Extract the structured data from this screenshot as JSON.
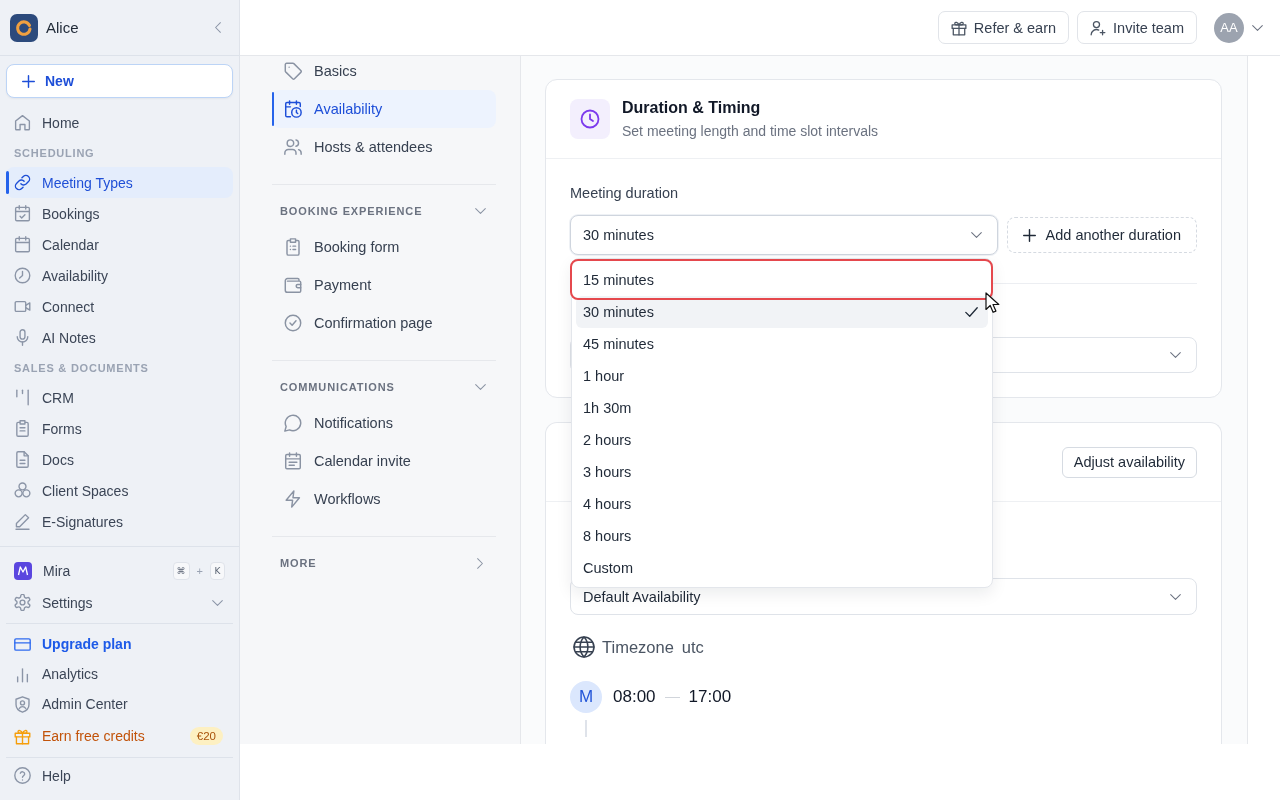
{
  "sidebar": {
    "workspace": "Alice",
    "new_button": "New",
    "top_items": [
      {
        "label": "Home",
        "selected": false
      }
    ],
    "sections": [
      {
        "title": "SCHEDULING",
        "items": [
          {
            "label": "Meeting Types",
            "selected": true
          },
          {
            "label": "Bookings",
            "selected": false
          },
          {
            "label": "Calendar",
            "selected": false
          },
          {
            "label": "Availability",
            "selected": false
          },
          {
            "label": "Connect",
            "selected": false
          },
          {
            "label": "AI Notes",
            "selected": false
          }
        ]
      },
      {
        "title": "SALES & DOCUMENTS",
        "items": [
          {
            "label": "CRM",
            "selected": false
          },
          {
            "label": "Forms",
            "selected": false
          },
          {
            "label": "Docs",
            "selected": false
          },
          {
            "label": "Client Spaces",
            "selected": false
          },
          {
            "label": "E-Signatures",
            "selected": false
          }
        ]
      }
    ],
    "assistant": {
      "label": "Mira",
      "shortcut_keys": [
        "⌘",
        "K"
      ],
      "shortcut_joiner": "+"
    },
    "settings": {
      "label": "Settings",
      "expanded": false
    },
    "footer_items": [
      {
        "kind": "upgrade",
        "label": "Upgrade plan"
      },
      {
        "kind": "plain",
        "label": "Analytics"
      },
      {
        "kind": "plain",
        "label": "Admin Center"
      },
      {
        "kind": "reward",
        "label": "Earn free credits",
        "badge": "€20"
      }
    ],
    "help": "Help"
  },
  "top_bar": {
    "buttons": [
      "Refer & earn",
      "Invite team"
    ],
    "avatar": "AA"
  },
  "event_settings_nav": {
    "items": [
      {
        "label": "Basics",
        "selected": false
      },
      {
        "label": "Availability",
        "selected": true
      },
      {
        "label": "Hosts & attendees",
        "selected": false
      }
    ],
    "groups": [
      {
        "title": "BOOKING EXPERIENCE",
        "expanded": true,
        "items": [
          {
            "label": "Booking form",
            "selected": false
          },
          {
            "label": "Payment",
            "selected": false
          },
          {
            "label": "Confirmation page",
            "selected": false
          }
        ]
      },
      {
        "title": "COMMUNICATIONS",
        "expanded": true,
        "items": [
          {
            "label": "Notifications",
            "selected": false
          },
          {
            "label": "Calendar invite",
            "selected": false
          },
          {
            "label": "Workflows",
            "selected": false
          }
        ]
      },
      {
        "title": "MORE",
        "expanded": false
      }
    ]
  },
  "duration_card": {
    "title": "Duration & Timing",
    "subtitle": "Set meeting length and time slot intervals",
    "duration_label": "Meeting duration",
    "duration_select": {
      "value": "30 minutes",
      "expanded": true,
      "options": [
        {
          "label": "15 minutes",
          "selected": false,
          "highlighted": true
        },
        {
          "label": "30 minutes",
          "selected": true,
          "highlighted": false
        },
        {
          "label": "45 minutes",
          "selected": false,
          "highlighted": false
        },
        {
          "label": "1 hour",
          "selected": false,
          "highlighted": false
        },
        {
          "label": "1h 30m",
          "selected": false,
          "highlighted": false
        },
        {
          "label": "2 hours",
          "selected": false,
          "highlighted": false
        },
        {
          "label": "3 hours",
          "selected": false,
          "highlighted": false
        },
        {
          "label": "4 hours",
          "selected": false,
          "highlighted": false
        },
        {
          "label": "8 hours",
          "selected": false,
          "highlighted": false
        },
        {
          "label": "Custom",
          "selected": false,
          "highlighted": false
        }
      ]
    },
    "add_button": "Add another duration"
  },
  "availability_card": {
    "button": "Adjust availability",
    "schedule_select": {
      "value": "Default Availability"
    },
    "timezone_label": "Timezone",
    "timezone": "utc",
    "days": [
      {
        "day": "M",
        "start": "08:00",
        "end": "17:00"
      }
    ]
  }
}
